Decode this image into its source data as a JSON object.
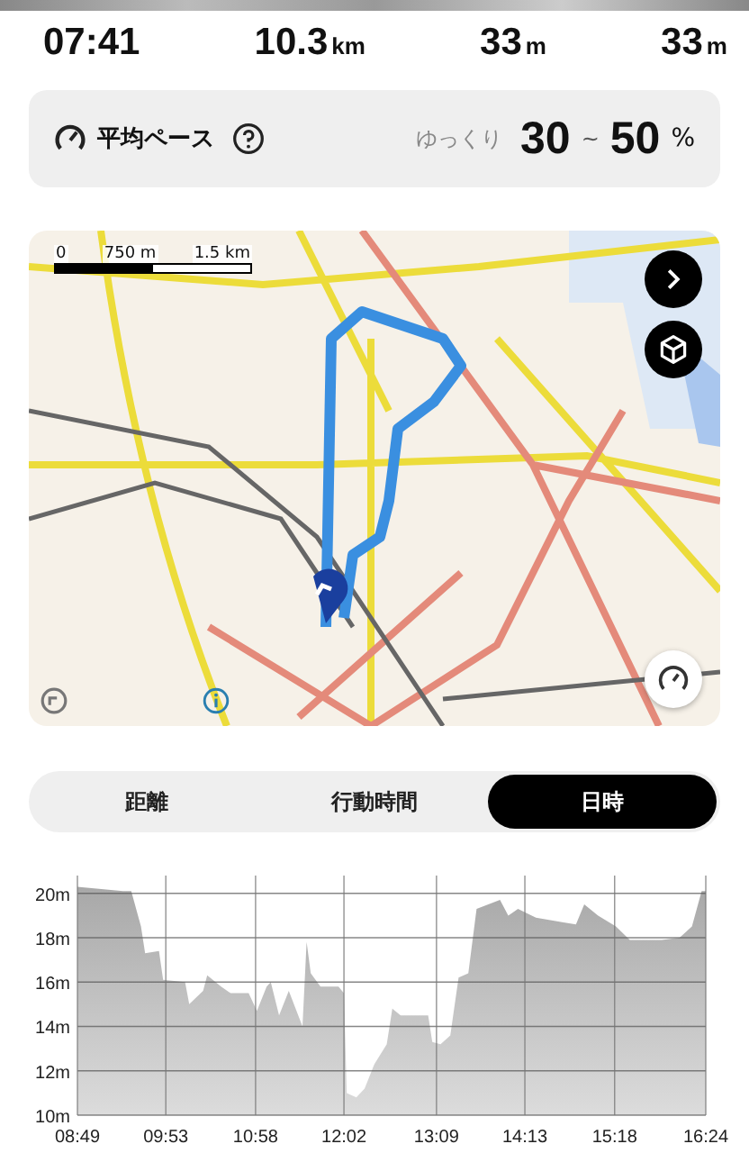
{
  "stats": [
    {
      "value": "07:41"
    },
    {
      "value": "10.3",
      "unit": "km"
    },
    {
      "value": "33",
      "unit": "m"
    },
    {
      "value": "33",
      "unit": "m"
    }
  ],
  "pace": {
    "label": "平均ペース",
    "speed_label": "ゆっくり",
    "min": "30",
    "separator": "~",
    "max": "50",
    "unit": "%"
  },
  "map": {
    "scale": [
      "0",
      "750 m",
      "1.5 km"
    ]
  },
  "tabs": [
    {
      "label": "距離",
      "selected": false
    },
    {
      "label": "行動時間",
      "selected": false
    },
    {
      "label": "日時",
      "selected": true
    }
  ],
  "elevation": {
    "chart_data": {
      "type": "area",
      "ylim": [
        10,
        20.8
      ],
      "xlim": [
        529,
        984
      ],
      "grid": true,
      "yticks": [
        {
          "value": 10,
          "label": "10m"
        },
        {
          "value": 12,
          "label": "12m"
        },
        {
          "value": 14,
          "label": "14m"
        },
        {
          "value": 16,
          "label": "16m"
        },
        {
          "value": 18,
          "label": "18m"
        },
        {
          "value": 20,
          "label": "20m"
        }
      ],
      "xticks": [
        {
          "value": 529,
          "label": "08:49"
        },
        {
          "value": 593,
          "label": "09:53"
        },
        {
          "value": 658,
          "label": "10:58"
        },
        {
          "value": 722,
          "label": "12:02"
        },
        {
          "value": 789,
          "label": "13:09"
        },
        {
          "value": 853,
          "label": "14:13"
        },
        {
          "value": 918,
          "label": "15:18"
        },
        {
          "value": 984,
          "label": "16:24"
        }
      ],
      "x": [
        529,
        562,
        568,
        575,
        578,
        588,
        591,
        607,
        610,
        620,
        623,
        633,
        640,
        653,
        659,
        666,
        669,
        675,
        682,
        692,
        695,
        698,
        705,
        718,
        722,
        724,
        731,
        737,
        744,
        753,
        757,
        763,
        783,
        786,
        792,
        799,
        805,
        812,
        818,
        835,
        841,
        848,
        861,
        880,
        890,
        896,
        906,
        919,
        929,
        952,
        965,
        974,
        981,
        984
      ],
      "series": [
        {
          "color": "#a8a8a8",
          "values": [
            20.3,
            20.1,
            20.1,
            18.5,
            17.3,
            17.4,
            16.1,
            16.0,
            15.0,
            15.6,
            16.3,
            15.8,
            15.5,
            15.5,
            14.7,
            15.8,
            16.0,
            14.5,
            15.6,
            14.0,
            17.8,
            16.4,
            15.8,
            15.8,
            15.5,
            11.0,
            10.8,
            11.2,
            12.3,
            13.2,
            14.8,
            14.5,
            14.5,
            13.3,
            13.2,
            13.6,
            16.2,
            16.4,
            19.3,
            19.7,
            19.0,
            19.3,
            18.9,
            18.7,
            18.6,
            19.5,
            19.0,
            18.5,
            17.9,
            17.9,
            18.0,
            18.5,
            20.1,
            20.1
          ]
        }
      ]
    }
  }
}
